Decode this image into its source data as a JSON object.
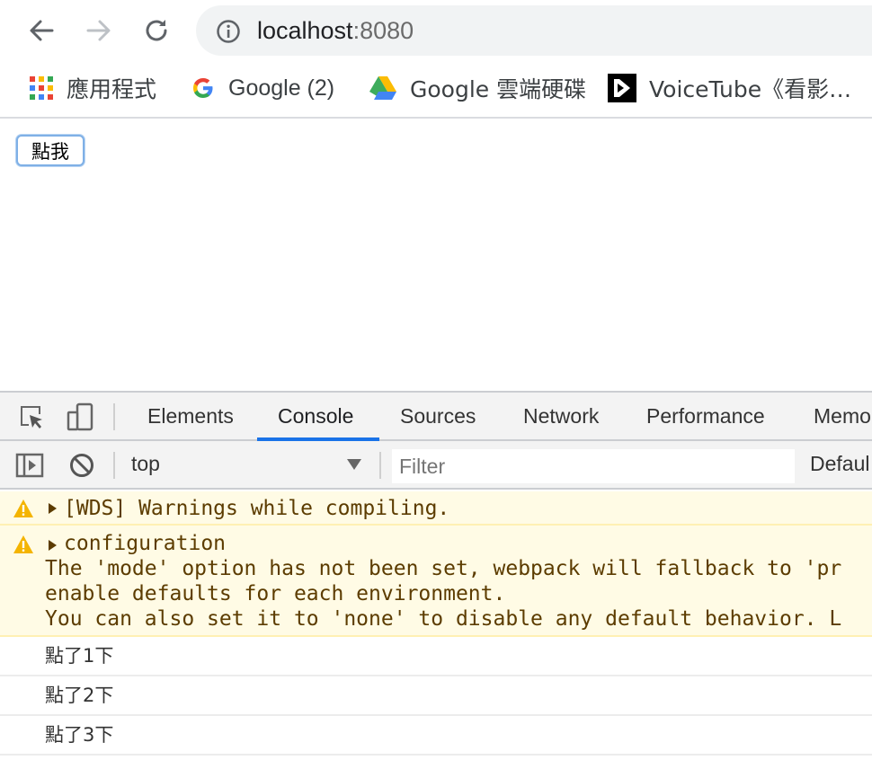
{
  "browser": {
    "url_host": "localhost",
    "url_port": ":8080",
    "icons": {
      "back": "arrow-left-icon",
      "forward": "arrow-right-icon",
      "reload": "reload-icon",
      "site_info": "info-icon"
    }
  },
  "bookmarks": [
    {
      "label": "應用程式",
      "icon": "apps-grid-icon"
    },
    {
      "label": "Google (2)",
      "icon": "google-g-icon"
    },
    {
      "label": "Google 雲端硬碟",
      "icon": "google-drive-icon"
    },
    {
      "label": "VoiceTube《看影…",
      "icon": "voicetube-icon"
    }
  ],
  "page": {
    "button_label": "點我"
  },
  "devtools": {
    "tabs": [
      "Elements",
      "Console",
      "Sources",
      "Network",
      "Performance",
      "Memo"
    ],
    "active_tab": "Console",
    "context": "top",
    "filter_placeholder": "Filter",
    "levels_label": "Defaul",
    "accent_color": "#1a73e8"
  },
  "console": {
    "warnings": [
      {
        "lines": [
          "[WDS] Warnings while compiling."
        ]
      },
      {
        "lines": [
          "configuration",
          "The 'mode' option has not been set, webpack will fallback to 'pr",
          "enable defaults for each environment.",
          "You can also set it to 'none' to disable any default behavior. L"
        ]
      }
    ],
    "logs": [
      "點了1下",
      "點了2下",
      "點了3下"
    ],
    "warn_bg_color": "#fffbe5",
    "warn_text_color": "#5c3c00"
  }
}
